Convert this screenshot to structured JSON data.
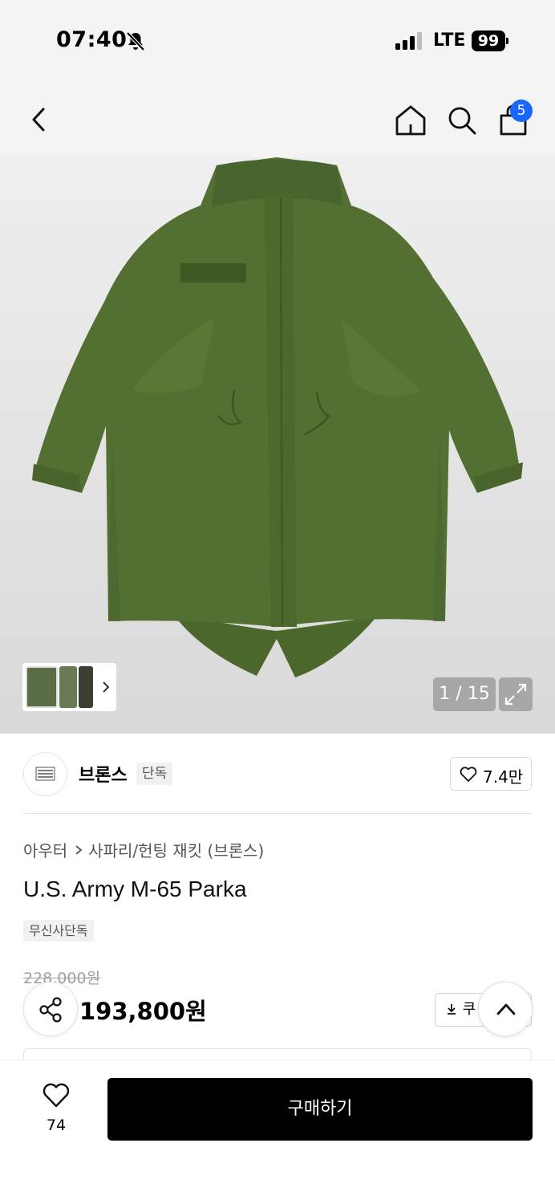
{
  "status_bar": {
    "time": "07:40",
    "network": "LTE",
    "battery": "99"
  },
  "header": {
    "cart_count": "5"
  },
  "product_image": {
    "counter": "1 / 15"
  },
  "brand": {
    "name": "브론스",
    "exclusive_label": "단독",
    "like_count": "7.4만"
  },
  "breadcrumb": {
    "level1": "아우터",
    "level2": "사파리/헌팅 재킷 (브론스)"
  },
  "product": {
    "title": "U.S. Army M-65 Parka",
    "tag": "무신사단독",
    "original_price": "228,000원",
    "sale_price": "193,800원",
    "coupon_label": "쿠"
  },
  "bottom_bar": {
    "wish_count": "74",
    "buy_label": "구매하기"
  },
  "colors": {
    "accent_badge": "#1967ff",
    "jacket_olive": "#4f6a30",
    "buy_button": "#000000"
  }
}
